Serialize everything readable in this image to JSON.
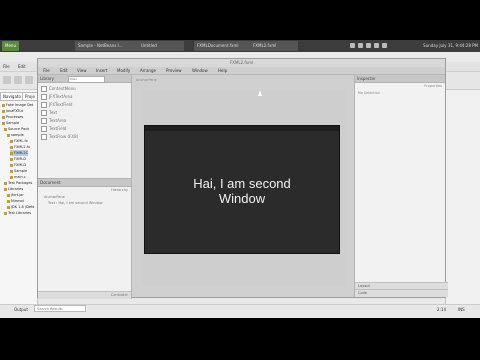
{
  "taskbar": {
    "menu_label": "Menu",
    "windows": [
      "Sample - NetBeans I...",
      "Untitled",
      "FXMLDocument.fxml",
      "FXML2.fxml"
    ],
    "clock": "Sunday July 31, 9:44:28 PM"
  },
  "netbeans": {
    "menu": [
      "File",
      "Edit",
      "View",
      "Navigate",
      "Source",
      "Refactor",
      "Run",
      "Debug",
      "Profile",
      "Team",
      "Tools",
      "Window",
      "Help"
    ],
    "tabs": [
      "Navigato",
      "Proje"
    ],
    "tree": [
      "Fake Image Det",
      "JavaFXTut",
      "Processes",
      "Sample",
      "Source Pack",
      "sample",
      "FXML.fx",
      "FXML2.fx",
      "FXML2C",
      "FXMLD",
      "FXMLD",
      "Sample",
      "main.c",
      "Test Packages",
      "Libraries",
      "jfxrt.jar",
      "Nimrod",
      "JDK 1.8 (Defa",
      "Test Libraries"
    ],
    "status": {
      "output": "Output",
      "search_placeholder": "Search Results",
      "line_col": "2:14",
      "ins": "INS"
    }
  },
  "scene_builder": {
    "title": "FXML2.fxml",
    "menu": [
      "File",
      "Edit",
      "View",
      "Insert",
      "Modify",
      "Arrange",
      "Preview",
      "Window",
      "Help"
    ],
    "library": {
      "title": "Library",
      "search_placeholder": "filter",
      "items": [
        "ContextMenu",
        "JFXTextArea",
        "JFXTextField",
        "Text",
        "TextArea",
        "TextField",
        "TextFlow  (FX8)"
      ]
    },
    "document": {
      "title": "Document",
      "hierarchy_label": "Hierarchy",
      "items": [
        "AnchorPane",
        "Text : Hai, I am second Window"
      ],
      "footer": "Controller"
    },
    "canvas": {
      "path": "AnchorPane"
    },
    "inspector": {
      "title": "Inspector",
      "properties_label": "Properties",
      "selection": "No Selection",
      "footers": [
        "Layout",
        "Code"
      ]
    }
  },
  "popup": {
    "message": "Hai, I am second Window"
  }
}
